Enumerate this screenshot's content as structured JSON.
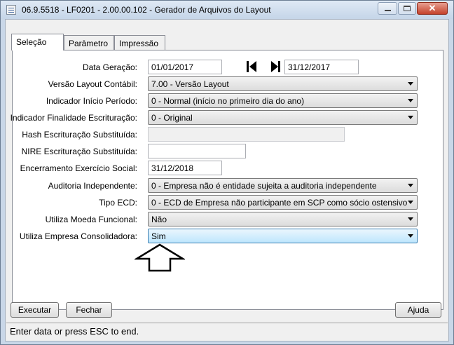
{
  "window": {
    "title": "06.9.5518 - LF0201 - 2.00.00.102 - Gerador de Arquivos do Layout",
    "close_glyph": "✕",
    "icons": {
      "app": "app-icon",
      "minimize": "minimize-icon",
      "maximize": "maximize-icon",
      "close": "close-icon"
    }
  },
  "tabs": [
    {
      "label": "Seleção",
      "active": true
    },
    {
      "label": "Parâmetro",
      "active": false
    },
    {
      "label": "Impressão",
      "active": false
    }
  ],
  "form": {
    "data_geracao": {
      "label": "Data Geração:",
      "start": "01/01/2017",
      "end": "31/12/2017"
    },
    "versao_layout": {
      "label": "Versão Layout Contábil:",
      "value": "7.00 - Versão Layout"
    },
    "indicador_inicio": {
      "label": "Indicador Início Período:",
      "value": "0 - Normal (início no primeiro dia do ano)"
    },
    "indicador_finalidade": {
      "label": "Indicador Finalidade Escrituração:",
      "value": "0 - Original"
    },
    "hash_escrituracao": {
      "label": "Hash Escrituração Substituída:",
      "value": ""
    },
    "nire_escrituracao": {
      "label": "NIRE Escrituração Substituída:",
      "value": ""
    },
    "encerramento": {
      "label": "Encerramento Exercício Social:",
      "value": "31/12/2018"
    },
    "auditoria": {
      "label": "Auditoria Independente:",
      "value": "0 - Empresa não é entidade sujeita a auditoria independente"
    },
    "tipo_ecd": {
      "label": "Tipo ECD:",
      "value": "0 - ECD de Empresa não participante em SCP como sócio ostensivo"
    },
    "moeda_funcional": {
      "label": "Utiliza Moeda Funcional:",
      "value": "Não"
    },
    "empresa_consolidadora": {
      "label": "Utiliza Empresa Consolidadora:",
      "value": "Sim"
    }
  },
  "buttons": {
    "executar": "Executar",
    "fechar": "Fechar",
    "ajuda": "Ajuda"
  },
  "status": {
    "text": "Enter data or press ESC to end."
  },
  "icons": {
    "first": "first-record-icon",
    "last": "last-record-icon",
    "annotation": "up-arrow-icon"
  }
}
